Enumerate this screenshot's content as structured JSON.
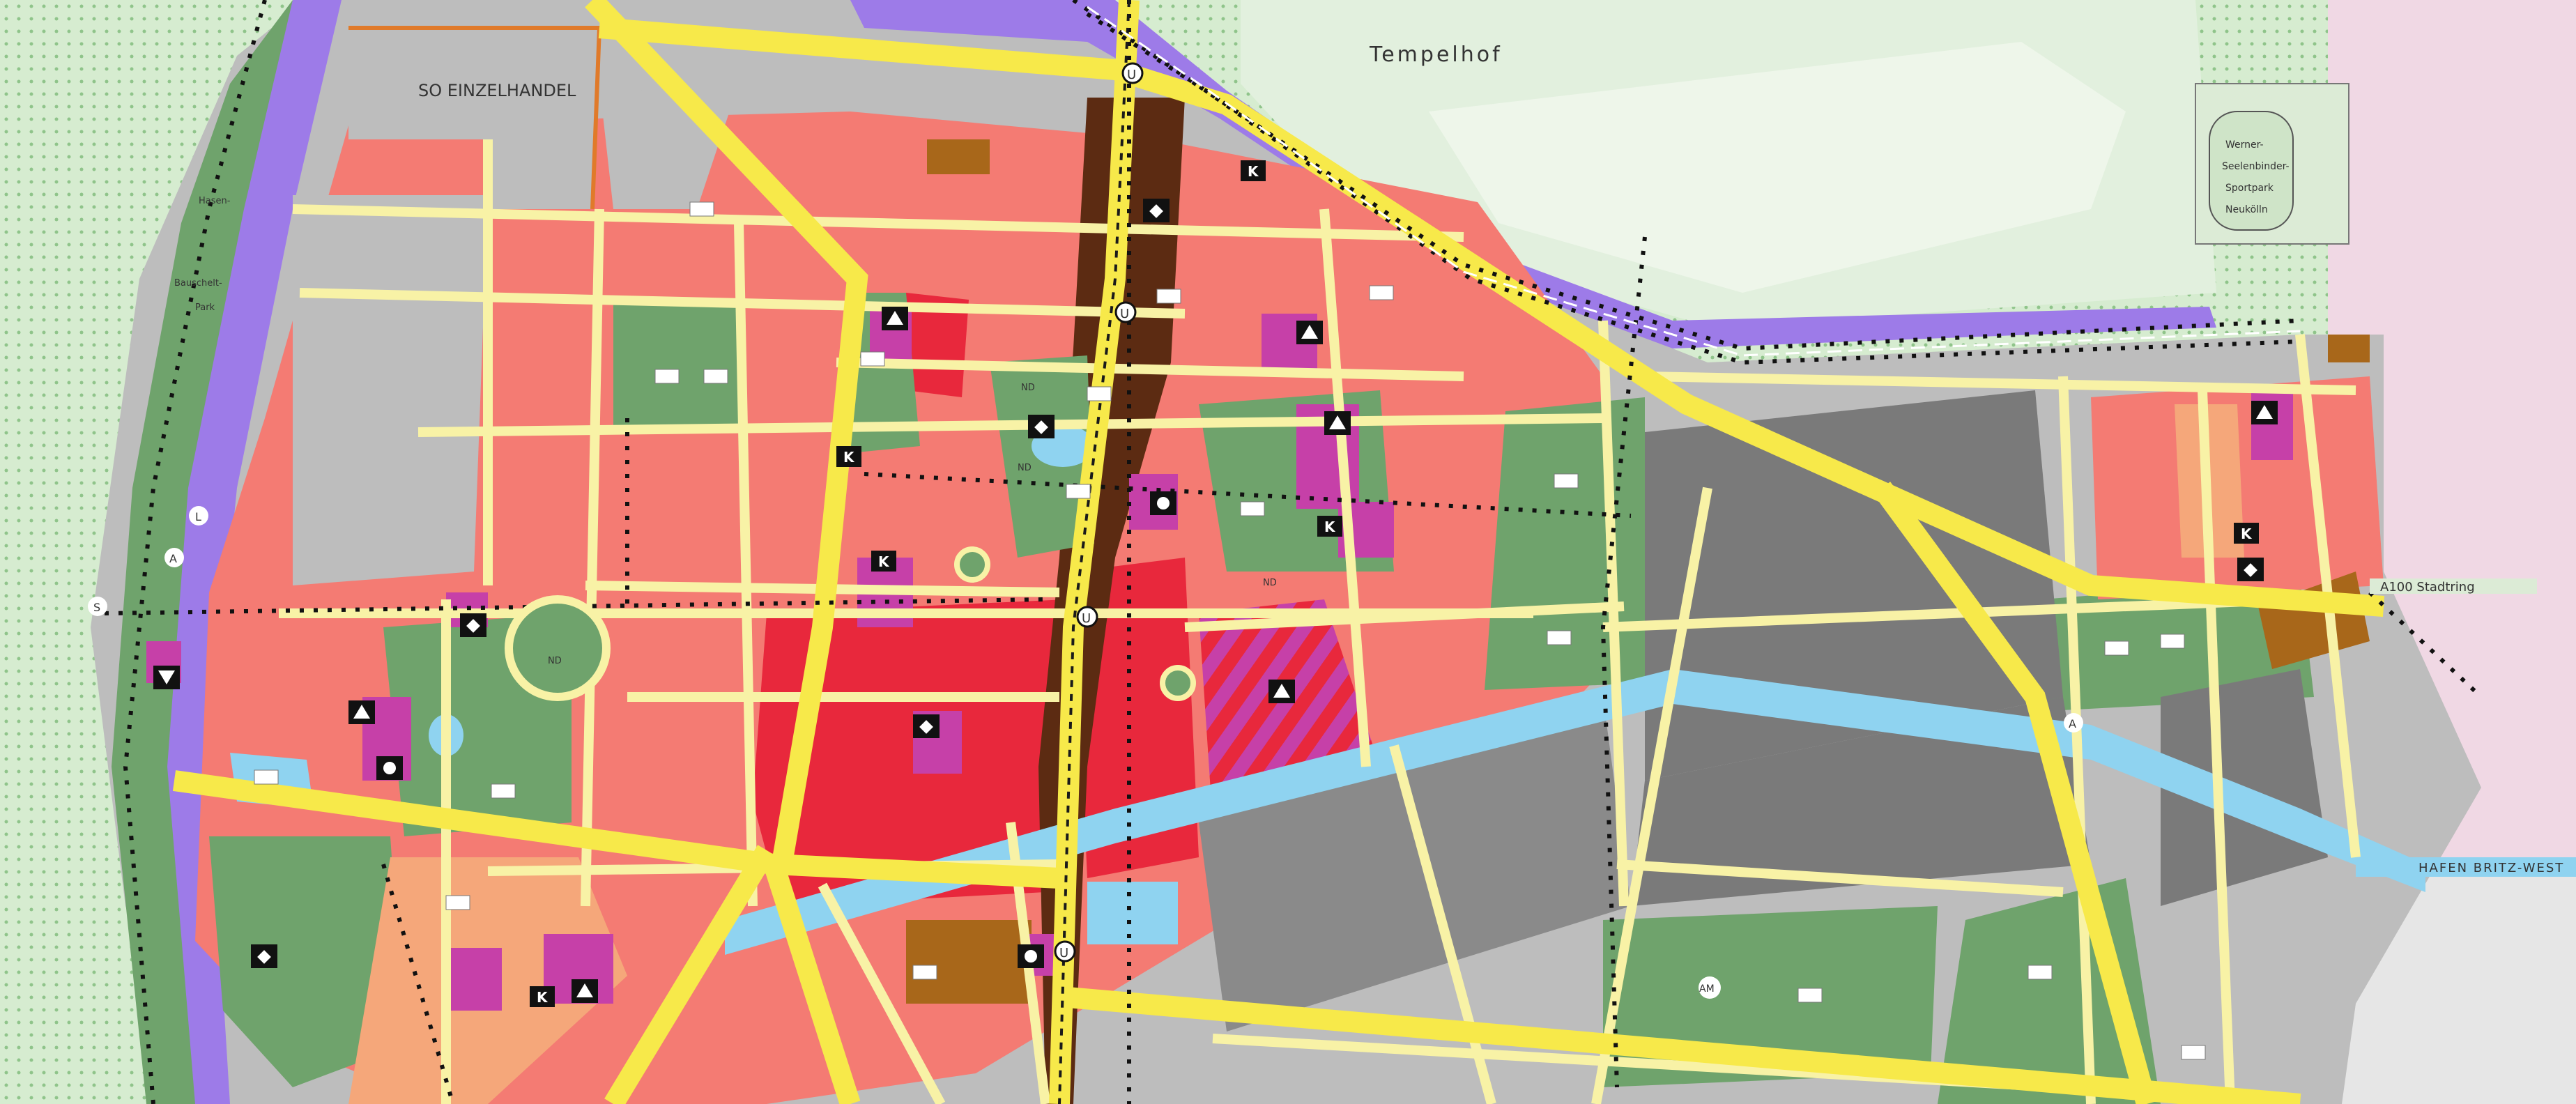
{
  "map": {
    "district_label": "Tempelhof",
    "zone_label": "SO EINZELHANDEL",
    "ring_road_label": "A100 Stadtring",
    "harbor_label": "HAFEN BRITZ-WEST",
    "sports": {
      "name_1": "Werner-",
      "name_2": "Seelenbinder-",
      "name_3": "Sportpark",
      "name_4": "Neukölln"
    },
    "left_park": {
      "name_1": "Hasen-",
      "name_2": "Bauschelt-",
      "name_3": "Park"
    },
    "small_labels": {
      "nd": "ND",
      "ubahn": "U",
      "k": "K",
      "a": "A",
      "s": "S",
      "l": "L",
      "am": "AM"
    },
    "colors": {
      "residential": "#f47b73",
      "core": "#e8283c",
      "commercial_gray": "#bdbdbd",
      "industrial_dark": "#7a7a7a",
      "green": "#6fa36c",
      "park_light": "#d8ecd2",
      "water": "#8fd3f0",
      "rail_purple": "#9d7be8",
      "road_yellow": "#f7e94a",
      "minor_road": "#f8f2a6",
      "brown": "#5c2b12",
      "ochre": "#a8671a",
      "magenta": "#c640a8"
    }
  }
}
